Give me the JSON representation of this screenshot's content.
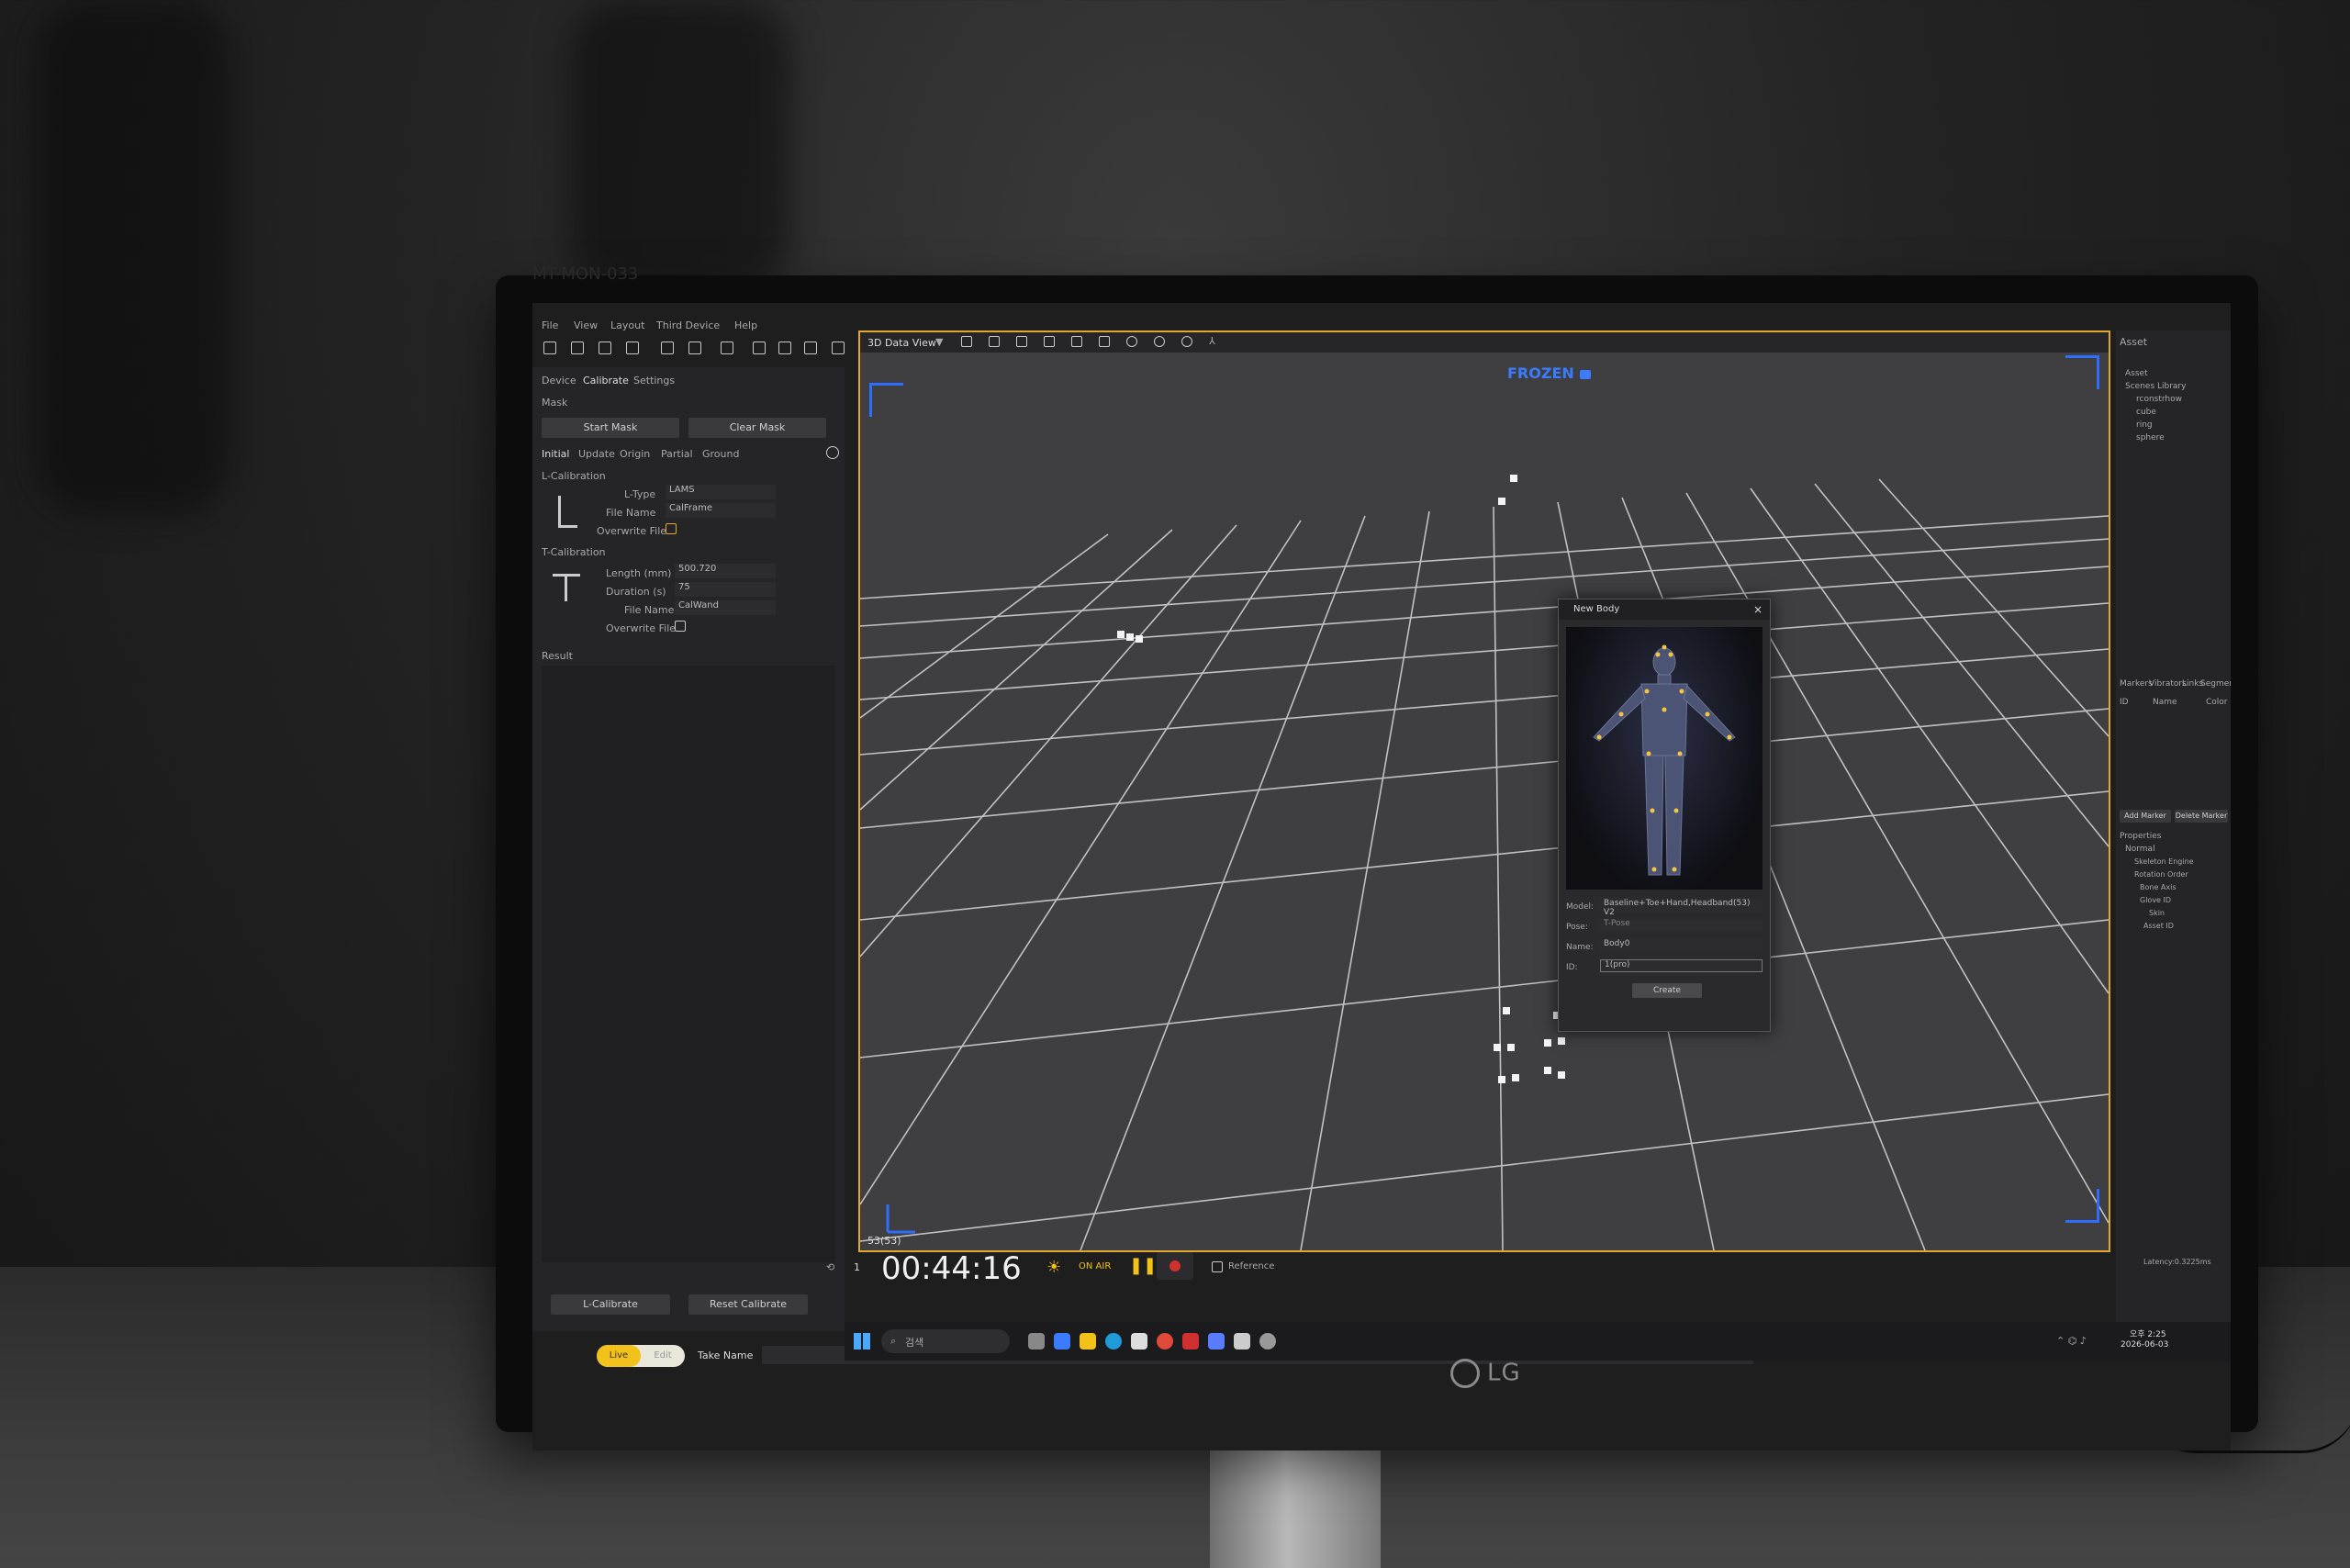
{
  "monitor": {
    "brand": "LG",
    "label": "MT-MON-033"
  },
  "app": {
    "menu": [
      "File",
      "View",
      "Layout",
      "Third Device",
      "Help"
    ],
    "left_panel": {
      "tabs": [
        "Device",
        "Calibrate",
        "Settings"
      ],
      "mask_section": "Mask",
      "start_mask": "Start Mask",
      "clear_mask": "Clear Mask",
      "sub_tabs": [
        "Initial",
        "Update",
        "Origin",
        "Partial",
        "Ground"
      ],
      "l_calibration": "L-Calibration",
      "l_type_label": "L-Type",
      "l_type_value": "LAMS",
      "file_name_label": "File Name",
      "file_name_value": "CalFrame",
      "overwrite_label": "Overwrite File",
      "t_calibration": "T-Calibration",
      "length_label": "Length (mm)",
      "length_value": "500.720",
      "duration_label": "Duration (s)",
      "duration_value": "75",
      "t_file_name_value": "CalWand",
      "result": "Result",
      "l_calibrate_btn": "L-Calibrate",
      "reset_calibrate_btn": "Reset Calibrate",
      "toggle_live": "Live",
      "toggle_edit": "Edit",
      "take_name": "Take Name"
    },
    "viewport": {
      "view_label": "3D Data View",
      "frozen": "FROZEN",
      "frame_counter": "53(53)"
    },
    "dialog": {
      "title": "New Body",
      "model_label": "Model:",
      "model_value": "Baseline+Toe+Hand,Headband(53) V2",
      "pose_label": "Pose:",
      "pose_value": "T-Pose",
      "name_label": "Name:",
      "name_value": "Body0",
      "id_label": "ID:",
      "id_value": "1(pro)",
      "create_btn": "Create"
    },
    "right_panel": {
      "asset_header": "Asset",
      "tree": [
        "Asset",
        "Scenes Library",
        "rconstrhow",
        "cube",
        "ring",
        "sphere"
      ],
      "tabs": [
        "Markers",
        "Vibrators",
        "Links",
        "Segments"
      ],
      "columns": [
        "ID",
        "Name",
        "Color"
      ],
      "add_marker": "Add Marker",
      "delete_marker": "Delete Marker",
      "properties": "Properties",
      "normal": "Normal",
      "props": [
        "Skeleton Engine",
        "Rotation Order",
        "Bone Axis",
        "Glove ID",
        "Skin",
        "Asset ID"
      ],
      "latency": "Latency:0.3225ms"
    },
    "transport": {
      "speed": "1",
      "timecode": "00:44:16",
      "on_air": "ON AIR",
      "reference": "Reference"
    }
  },
  "taskbar": {
    "search_placeholder": "검색",
    "clock_time": "오후 2:25",
    "clock_date": "2026-06-03"
  },
  "colors": {
    "accent_orange": "#e0a82e",
    "frozen_blue": "#3b7cff",
    "record_red": "#d03030",
    "pause_yellow": "#f2c21b"
  }
}
